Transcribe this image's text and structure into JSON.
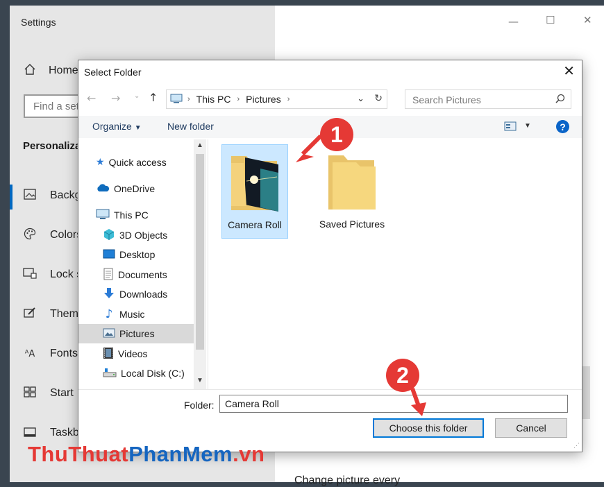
{
  "settings": {
    "title": "Settings",
    "home_label": "Home",
    "search_placeholder": "Find a setting",
    "section_title": "Personalization",
    "nav_items": [
      {
        "label": "Background",
        "icon": "background-image-icon"
      },
      {
        "label": "Colors",
        "icon": "palette-icon"
      },
      {
        "label": "Lock screen",
        "icon": "lock-screen-icon"
      },
      {
        "label": "Themes",
        "icon": "themes-brush-icon"
      },
      {
        "label": "Fonts",
        "icon": "fonts-icon"
      },
      {
        "label": "Start",
        "icon": "start-tiles-icon"
      },
      {
        "label": "Taskbar",
        "icon": "taskbar-icon"
      }
    ],
    "bottom_text": "Change picture every",
    "accent_color": "#0067c0"
  },
  "dialog": {
    "title": "Select Folder",
    "breadcrumb": [
      "This PC",
      "Pictures"
    ],
    "search_placeholder": "Search Pictures",
    "toolbar": {
      "organize": "Organize",
      "new_folder": "New folder"
    },
    "tree": [
      {
        "label": "Quick access",
        "icon": "star-icon"
      },
      {
        "label": "OneDrive",
        "icon": "cloud-icon"
      },
      {
        "label": "This PC",
        "icon": "computer-icon"
      },
      {
        "label": "3D Objects",
        "icon": "cube-icon"
      },
      {
        "label": "Desktop",
        "icon": "desktop-icon"
      },
      {
        "label": "Documents",
        "icon": "document-icon"
      },
      {
        "label": "Downloads",
        "icon": "download-arrow-icon"
      },
      {
        "label": "Music",
        "icon": "music-note-icon"
      },
      {
        "label": "Pictures",
        "icon": "pictures-icon",
        "selected": true
      },
      {
        "label": "Videos",
        "icon": "film-icon"
      },
      {
        "label": "Local Disk (C:)",
        "icon": "drive-icon"
      }
    ],
    "files": [
      {
        "label": "Camera Roll",
        "selected": true
      },
      {
        "label": "Saved Pictures",
        "selected": false
      }
    ],
    "folder_label": "Folder:",
    "folder_value": "Camera Roll",
    "choose_button": "Choose this folder",
    "cancel_button": "Cancel"
  },
  "annotations": {
    "step1": "1",
    "step2": "2",
    "color": "#e53935"
  },
  "watermark": {
    "part1": "ThuThuat",
    "part2": "PhanMem",
    "part3": ".vn"
  }
}
